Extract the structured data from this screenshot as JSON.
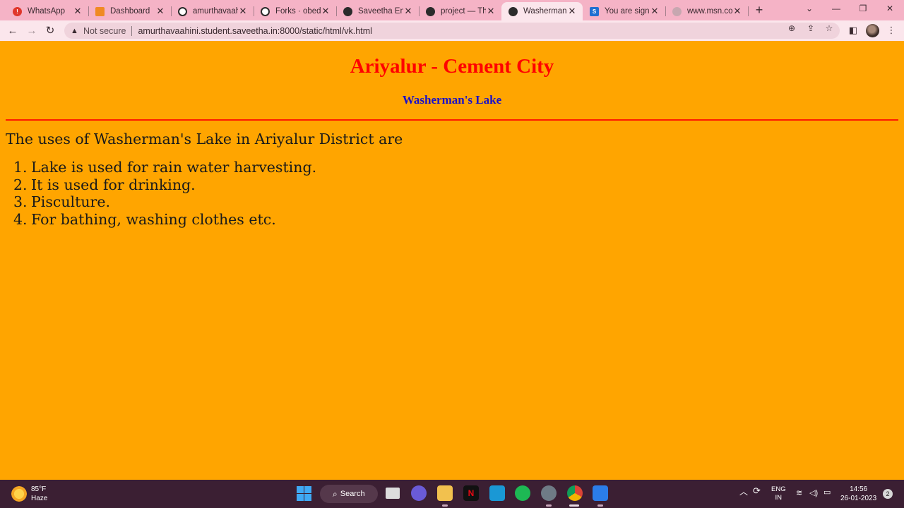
{
  "browser": {
    "tabs": [
      {
        "title": "WhatsApp",
        "icon": "whatsapp-icon",
        "color": "#e0362b"
      },
      {
        "title": "Dashboard",
        "icon": "dashboard-icon",
        "color": "#f08a24"
      },
      {
        "title": "amurthavaahi",
        "icon": "github-icon",
        "color": "#ffffff"
      },
      {
        "title": "Forks · obedo",
        "icon": "github-icon",
        "color": "#ffffff"
      },
      {
        "title": "Saveetha Engi",
        "icon": "globe-icon",
        "color": "#2b2b2b"
      },
      {
        "title": "project — The",
        "icon": "globe-icon",
        "color": "#2b2b2b"
      },
      {
        "title": "Washermanâ€",
        "icon": "globe-icon",
        "color": "#2b2b2b"
      },
      {
        "title": "You are signe",
        "icon": "s-icon",
        "color": "#1f6fd1"
      },
      {
        "title": "www.msn.com",
        "icon": "globe-icon",
        "color": "#c7a7b0"
      }
    ],
    "new_tab": "+",
    "address": {
      "security_label": "Not secure",
      "url": "amurthavaahini.student.saveetha.in:8000/static/html/vk.html"
    }
  },
  "page": {
    "title": "Ariyalur - Cement City",
    "subtitle": "Washerman's Lake",
    "intro": "The uses of Washerman's Lake in Ariyalur District are",
    "items": [
      "Lake is used for rain water harvesting.",
      "It is used for drinking.",
      "Pisculture.",
      "For bathing, washing clothes etc."
    ],
    "colors": {
      "background": "#ffa500",
      "title": "#ff0000",
      "subtitle": "#1a10c8",
      "rule": "#ff1a00"
    }
  },
  "taskbar": {
    "weather": {
      "temp": "85°F",
      "condition": "Haze"
    },
    "search_label": "Search",
    "language": {
      "line1": "ENG",
      "line2": "IN"
    },
    "clock": {
      "time": "14:56",
      "date": "26-01-2023"
    },
    "notifications": "2"
  }
}
